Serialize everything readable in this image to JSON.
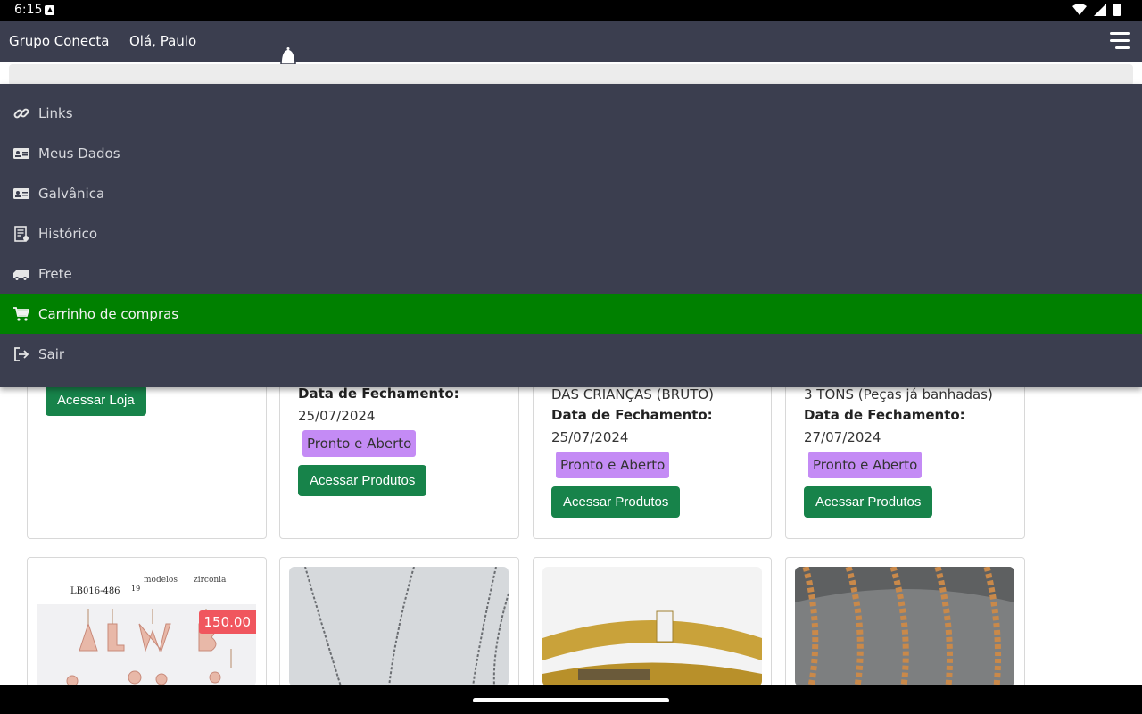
{
  "status_bar": {
    "time": "6:15",
    "wifi_icon": "wifi-icon",
    "signal_icon": "signal-icon",
    "battery_icon": "battery-icon"
  },
  "header": {
    "brand": "Grupo Conecta",
    "greeting": "Olá, Paulo"
  },
  "menu": {
    "items": [
      {
        "label": "Links",
        "icon": "link-icon"
      },
      {
        "label": "Meus Dados",
        "icon": "id-card-icon"
      },
      {
        "label": "Galvânica",
        "icon": "id-card-icon"
      },
      {
        "label": "Histórico",
        "icon": "receipt-icon"
      },
      {
        "label": "Frete",
        "icon": "truck-icon"
      },
      {
        "label": "Carrinho de compras",
        "icon": "cart-icon",
        "active": true
      },
      {
        "label": "Sair",
        "icon": "logout-icon"
      }
    ],
    "active_color": "#008000"
  },
  "cards_row1": [
    {
      "button": "Acessar Loja"
    },
    {
      "label": "Data de Fechamento:",
      "date": "25/07/2024",
      "badge": "Pronto e Aberto",
      "button": "Acessar Produtos"
    },
    {
      "title_tail": "DAS CRIANÇAS (BRUTO)",
      "label": "Data de Fechamento:",
      "date": "25/07/2024",
      "badge": "Pronto e Aberto",
      "button": "Acessar Produtos"
    },
    {
      "title_tail": "3 TONS (Peças já banhadas)",
      "label": "Data de Fechamento:",
      "date": "27/07/2024",
      "badge": "Pronto e Aberto",
      "button": "Acessar Produtos"
    }
  ],
  "cards_row2": [
    {
      "price": "150.00",
      "img_text_code": "LB016-486",
      "img_text_models": "modelos",
      "img_text_zirconia": "zirconia",
      "img_text_count": "19"
    },
    {},
    {},
    {}
  ],
  "colors": {
    "topbar": "#3b3e4f",
    "badge": "#c48bf5",
    "button": "#17834a",
    "price": "#f0565e"
  }
}
